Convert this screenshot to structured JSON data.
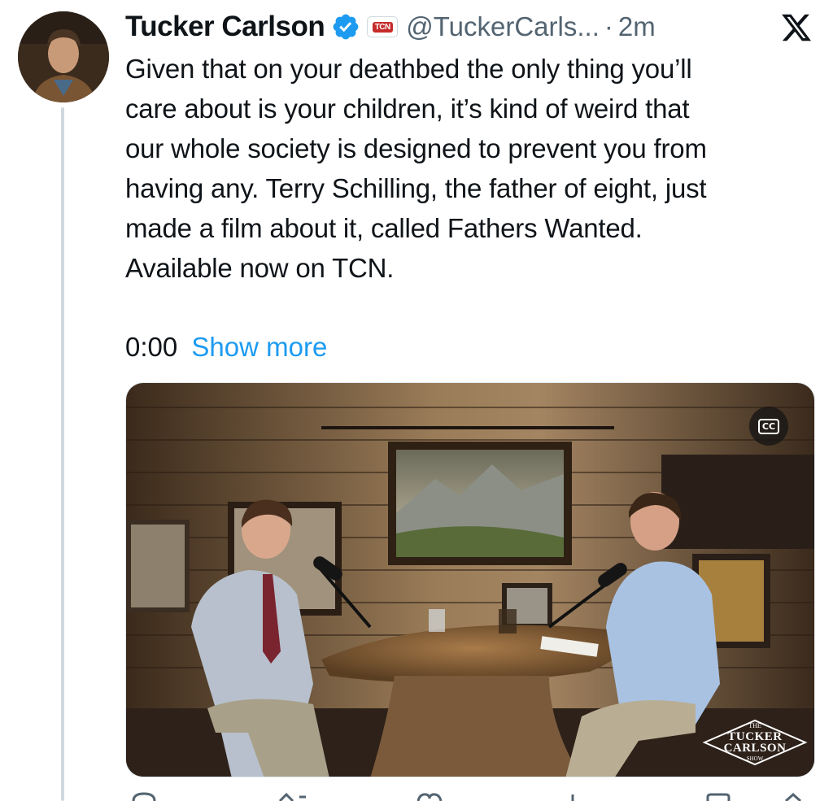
{
  "author": {
    "name": "Tucker Carlson",
    "handle": "@TuckerCarls...",
    "time": "2m",
    "separator": "·",
    "affiliate_badge": "TCN"
  },
  "tweet": {
    "text": "Given that on your deathbed the only thing you’ll\ncare about is your children, it’s kind of weird that\nour whole society is designed to prevent you from\nhaving any. Terry Schilling, the father of eight, just\nmade a film about it, called Fathers Wanted.\nAvailable now on TCN."
  },
  "video": {
    "timer": "0:00",
    "show_more": "Show more",
    "cc_label": "CC",
    "watermark_small": "THE",
    "watermark_line1": "TUCKER",
    "watermark_line2": "CARLSON",
    "watermark_show": "SHOW"
  },
  "icons": {
    "verified": "verified-badge-icon",
    "platform": "x-logo-icon",
    "captions": "closed-captions-icon",
    "actions": [
      "reply-icon",
      "repost-icon",
      "like-icon",
      "views-icon",
      "bookmark-icon",
      "share-icon"
    ]
  },
  "colors": {
    "accent": "#1d9bf0",
    "secondary_text": "#536471",
    "thread_line": "#cfd9de",
    "affiliate_red": "#c62b2b"
  }
}
